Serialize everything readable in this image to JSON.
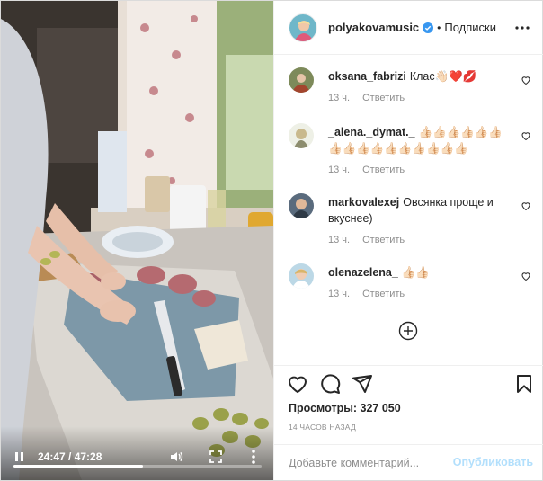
{
  "video": {
    "time_label": "24:47 / 47:28",
    "progress": 0.522,
    "icons": {
      "play_pause": "pause-icon",
      "volume": "volume-icon",
      "fullscreen": "fullscreen-icon",
      "more": "more-vertical-icon"
    }
  },
  "header": {
    "username": "polyakovamusic",
    "separator": "•",
    "follow_label": "Подписки",
    "verified_color": "#3897f0"
  },
  "comments": [
    {
      "user": "oksana_fabrizi",
      "text": "Клас👋🏻❤️💋",
      "time": "13 ч.",
      "reply": "Ответить"
    },
    {
      "user": "_alena._dymat._",
      "text": "👍🏻👍🏻👍🏻👍🏻👍🏻👍🏻👍🏻👍🏻👍🏻👍🏻👍🏻👍🏻👍🏻👍🏻👍🏻👍🏻",
      "time": "13 ч.",
      "reply": "Ответить"
    },
    {
      "user": "markovalexej",
      "text": "Овсянка проще и вкуснее)",
      "time": "13 ч.",
      "reply": "Ответить"
    },
    {
      "user": "olenazelena_",
      "text": "👍🏻👍🏻",
      "time": "13 ч.",
      "reply": "Ответить"
    }
  ],
  "actions": {
    "views_label": "Просмотры:",
    "views_count": "327 050",
    "time_ago": "14 ЧАСОВ НАЗАД"
  },
  "add_comment": {
    "placeholder": "Добавьте комментарий...",
    "publish_label": "Опубликовать"
  },
  "colors": {
    "publish_disabled": "#b2dffc",
    "muted": "#8e8e8e",
    "text": "#262626"
  }
}
